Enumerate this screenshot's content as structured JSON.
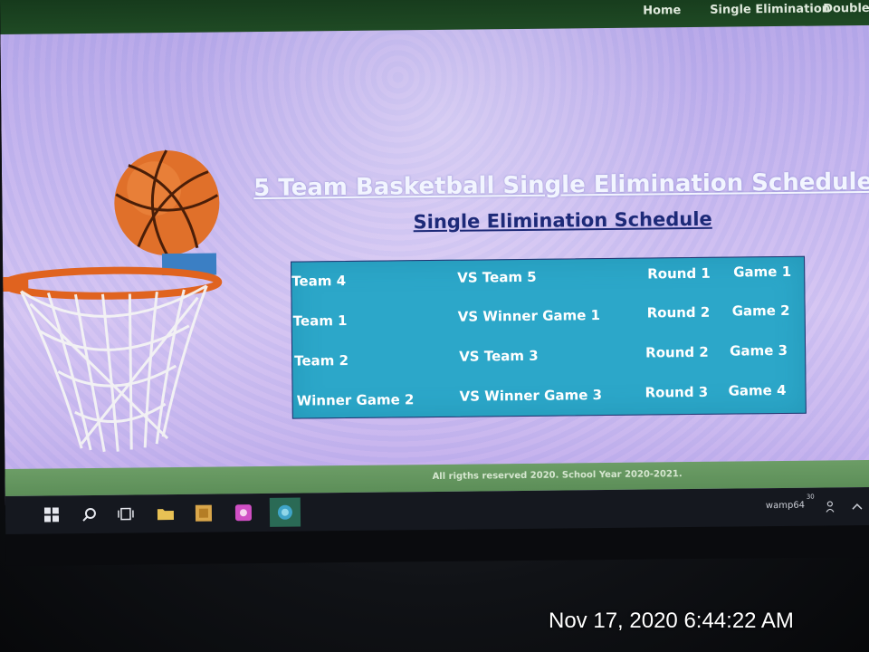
{
  "nav": {
    "home": "Home",
    "single_elimination": "Single Elimination",
    "double_elimination": "Double El"
  },
  "page": {
    "title": "5 Team Basketball Single Elimination Schedule",
    "subtitle": "Single Elimination Schedule"
  },
  "schedule": {
    "rows": [
      {
        "team": "Team 4",
        "vs": "VS Team 5",
        "round": "Round 1",
        "game": "Game 1"
      },
      {
        "team": "Team 1",
        "vs": "VS Winner Game 1",
        "round": "Round 2",
        "game": "Game 2"
      },
      {
        "team": "Team 2",
        "vs": "VS Team 3",
        "round": "Round 2",
        "game": "Game 3"
      },
      {
        "team": "Winner Game 2",
        "vs": "VS Winner Game 3",
        "round": "Round 3",
        "game": "Game 4"
      }
    ]
  },
  "footer": {
    "text": "All rigths reserved 2020. School Year 2020-2021."
  },
  "taskbar": {
    "tray_label": "wamp64",
    "tray_superscript": "30"
  },
  "photo": {
    "timestamp": "Nov 17, 2020 6:44:22 AM"
  },
  "icons": [
    "windows-start-icon",
    "search-icon",
    "task-view-icon",
    "file-explorer-icon",
    "app-icon",
    "app-icon-purple",
    "browser-icon",
    "people-icon",
    "chevron-up-icon",
    "basketball-hoop-image",
    "mouse-cursor-icon"
  ],
  "colors": {
    "nav_bg": "#1f4a24",
    "table_bg": "#2ca7c9",
    "subtitle": "#1d2a78",
    "footer_bg": "#5c8e58",
    "taskbar_bg": "#15181f"
  }
}
